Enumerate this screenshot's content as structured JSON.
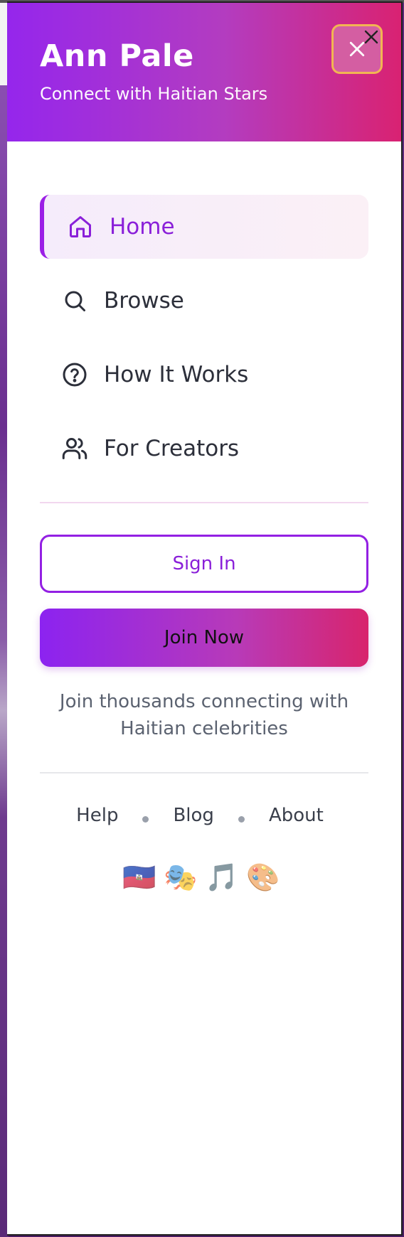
{
  "drawer": {
    "title": "Ann Pale",
    "subtitle": "Connect with Haitian Stars",
    "close_icon": "close-icon"
  },
  "nav": {
    "items": [
      {
        "label": "Home",
        "icon": "home-icon",
        "active": true
      },
      {
        "label": "Browse",
        "icon": "search-icon",
        "active": false
      },
      {
        "label": "How It Works",
        "icon": "help-circle-icon",
        "active": false
      },
      {
        "label": "For Creators",
        "icon": "users-icon",
        "active": false
      }
    ]
  },
  "auth": {
    "sign_in_label": "Sign In",
    "join_label": "Join Now",
    "tagline": "Join thousands connecting with Haitian celebrities"
  },
  "footer": {
    "links": [
      "Help",
      "Blog",
      "About"
    ],
    "emojis": [
      "🇭🇹",
      "🎭",
      "🎵",
      "🎨"
    ]
  },
  "colors": {
    "brand_purple": "#9526ec",
    "brand_pink": "#d92272",
    "active_text": "#8a1fd9"
  }
}
